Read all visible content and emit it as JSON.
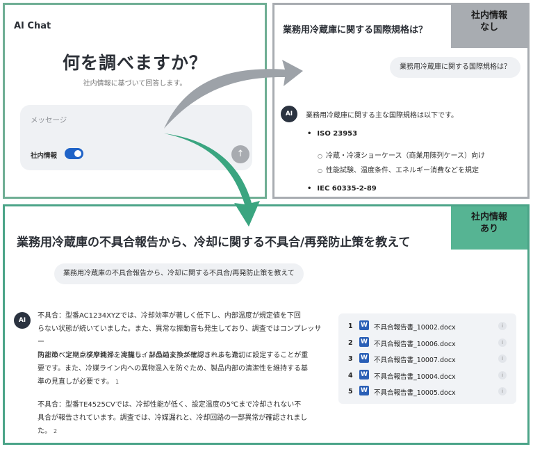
{
  "chat_panel": {
    "app_title": "AI Chat",
    "hero": "何を調べますか？",
    "hero_sub": "社内情報に基づいて回答します。",
    "message_placeholder": "メッセージ",
    "toggle_label": "社内情報",
    "toggle_on": true,
    "send_icon": "arrow-up-icon"
  },
  "no_info_panel": {
    "tag_line1": "社内情報",
    "tag_line2": "なし",
    "question_title": "業務用冷蔵庫に関する国際規格は？",
    "user_bubble": "業務用冷蔵庫に関する国際規格は？",
    "ai_badge": "AI",
    "answer_intro": "業務用冷蔵庫に関する主な国際規格は以下です。",
    "bullets": [
      {
        "title": "ISO 23953",
        "subs": [
          "冷蔵・冷凍ショーケース（商業用陳列ケース）向け",
          "性能試験、温度条件、エネルギー消費などを規定"
        ]
      },
      {
        "title": "IEC 60335-2-89",
        "subs": []
      }
    ]
  },
  "with_info_panel": {
    "tag_line1": "社内情報",
    "tag_line2": "あり",
    "question_title": "業務用冷蔵庫の不具合報告から、冷却に関する不具合/再発防止策を教えて",
    "user_bubble": "業務用冷蔵庫の不具合報告から、冷却に関する不具合/再発防止策を教えて",
    "ai_badge": "AI",
    "paragraph1_lines": [
      "不具合：型番AC1234XYZでは、冷却効率が著しく低下し、内部温度が規定値を下回",
      "らない状態が続いていました。また、異常な振動音も発生しており、調査ではコンプレッサー",
      "内部のベアリング摩耗と、冷媒ラインの詰まりが確認されました。"
    ],
    "paragraph1_cite": "1",
    "paragraph2_lines": [
      "防止策：定期点検や清掃を実施し、部品の交換スケジュールを適切に設定することが重",
      "要です。また、冷媒ライン内への異物混入を防ぐため、製品内部の清潔性を維持する基",
      "準の見直しが必要です。"
    ],
    "paragraph2_cite": "1",
    "paragraph3_lines": [
      "不具合：型番TE4525CVでは、冷却性能が低く、設定温度の5℃まで冷却されない不",
      "具合が報告されています。調査では、冷媒漏れと、冷却回路の一部異常が確認されまし",
      "た。"
    ],
    "paragraph3_cite": "2",
    "sources": [
      {
        "num": "1",
        "icon": "word-doc-icon",
        "icon_letter": "W",
        "name": "不具合報告書_10002.docx",
        "info_glyph": "i"
      },
      {
        "num": "2",
        "icon": "word-doc-icon",
        "icon_letter": "W",
        "name": "不具合報告書_10006.docx",
        "info_glyph": "i"
      },
      {
        "num": "3",
        "icon": "word-doc-icon",
        "icon_letter": "W",
        "name": "不具合報告書_10007.docx",
        "info_glyph": "i"
      },
      {
        "num": "4",
        "icon": "word-doc-icon",
        "icon_letter": "W",
        "name": "不具合報告書_10004.docx",
        "info_glyph": "i"
      },
      {
        "num": "5",
        "icon": "word-doc-icon",
        "icon_letter": "W",
        "name": "不具合報告書_10005.docx",
        "info_glyph": "i"
      }
    ]
  },
  "colors": {
    "no_info_border": "#a8acb1",
    "with_info_border": "#4ba488",
    "arrow_gray": "#9da2a8",
    "arrow_green": "#3aa580",
    "toggle_blue": "#1f63c7"
  }
}
